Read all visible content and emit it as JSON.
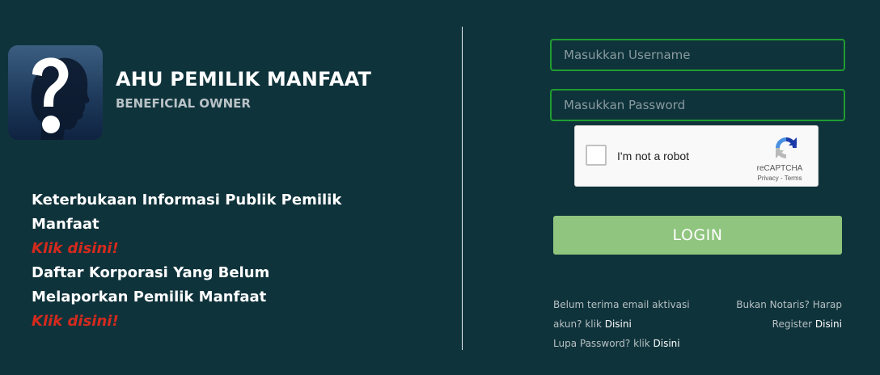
{
  "brand": {
    "title": "AHU PEMILIK MANFAAT",
    "subtitle": "BENEFICIAL OWNER"
  },
  "info_links": [
    {
      "text": "Keterbukaan Informasi Publik Pemilik Manfaat",
      "link": "Klik disini!"
    },
    {
      "text": "Daftar Korporasi Yang Belum Melaporkan Pemilik Manfaat",
      "link": "Klik disini!"
    }
  ],
  "form": {
    "username_placeholder": "Masukkan Username",
    "password_placeholder": "Masukkan Password",
    "login_label": "LOGIN"
  },
  "captcha": {
    "label": "I'm not a robot",
    "brand": "reCAPTCHA",
    "terms": "Privacy - Terms"
  },
  "footer": {
    "activation_text": "Belum terima email aktivasi akun? klik",
    "activation_link": "Disini",
    "notaris_text": "Bukan Notaris? Harap Register",
    "notaris_link": "Disini",
    "lupa_text": "Lupa Password? klik",
    "lupa_link": "Disini"
  },
  "colors": {
    "background": "#0f333b",
    "accent_green": "#1f9c31",
    "login_button": "#8fc57e",
    "link_red": "#d42a1e"
  },
  "icons": {
    "logo": "question-head-icon",
    "captcha": "recaptcha-icon"
  }
}
